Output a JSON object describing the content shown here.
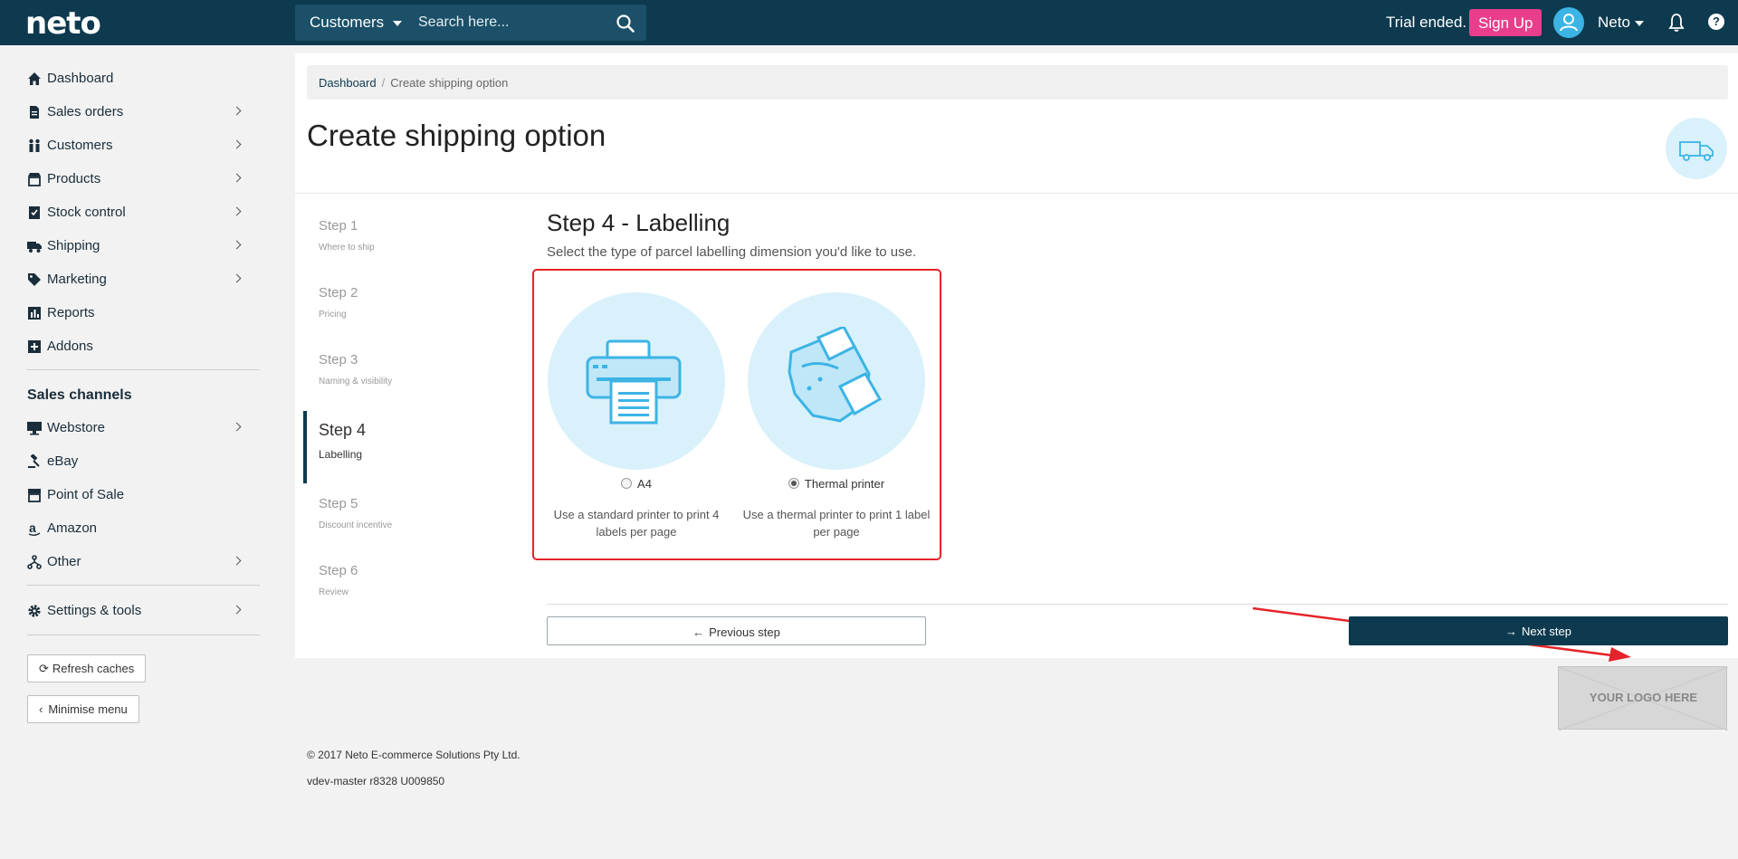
{
  "topbar": {
    "logo": "neto",
    "search_scope": "Customers",
    "search_placeholder": "Search here...",
    "trial_text": "Trial ended.",
    "signup_label": "Sign Up",
    "user_name": "Neto",
    "help_label": "?"
  },
  "sidebar": {
    "items": [
      {
        "label": "Dashboard",
        "icon": "home-icon"
      },
      {
        "label": "Sales orders",
        "icon": "document-icon"
      },
      {
        "label": "Customers",
        "icon": "people-icon"
      },
      {
        "label": "Products",
        "icon": "store-icon"
      },
      {
        "label": "Stock control",
        "icon": "checklist-icon"
      },
      {
        "label": "Shipping",
        "icon": "truck-icon"
      },
      {
        "label": "Marketing",
        "icon": "tag-icon"
      },
      {
        "label": "Reports",
        "icon": "bar-chart-icon"
      },
      {
        "label": "Addons",
        "icon": "plus-square-icon"
      }
    ],
    "channels_heading": "Sales channels",
    "channels": [
      {
        "label": "Webstore",
        "icon": "monitor-icon"
      },
      {
        "label": "eBay",
        "icon": "gavel-icon"
      },
      {
        "label": "Point of Sale",
        "icon": "register-icon"
      },
      {
        "label": "Amazon",
        "icon": "amazon-icon"
      },
      {
        "label": "Other",
        "icon": "branch-icon"
      }
    ],
    "settings_label": "Settings & tools",
    "refresh_label": "Refresh caches",
    "minimise_label": "Minimise menu"
  },
  "breadcrumb": {
    "home": "Dashboard",
    "separator": "/",
    "current": "Create shipping option"
  },
  "page_title": "Create shipping option",
  "steps": [
    {
      "num": "Step 1",
      "sub": "Where to ship"
    },
    {
      "num": "Step 2",
      "sub": "Pricing"
    },
    {
      "num": "Step 3",
      "sub": "Naming & visibility"
    },
    {
      "num": "Step 4",
      "sub": "Labelling"
    },
    {
      "num": "Step 5",
      "sub": "Discount incentive"
    },
    {
      "num": "Step 6",
      "sub": "Review"
    }
  ],
  "step_heading": "Step 4 - Labelling",
  "step_desc": "Select the type of parcel labelling dimension you'd like to use.",
  "options": [
    {
      "label": "A4",
      "desc": "Use a standard printer to print 4 labels per page",
      "checked": false
    },
    {
      "label": "Thermal printer",
      "desc": "Use a thermal printer to print 1 label per page",
      "checked": true
    }
  ],
  "prev_label": "Previous step",
  "next_label": "Next step",
  "logo_placeholder": "YOUR LOGO HERE",
  "footer": {
    "copyright": "© 2017 Neto E-commerce Solutions Pty Ltd.",
    "version": "vdev-master r8328 U009850"
  },
  "colors": {
    "topbar": "#0e3a4f",
    "accent_pink": "#e83e8c",
    "light_blue": "#d9f1fa",
    "icon_blue": "#3cb4e5",
    "annotation_red": "#e4242a"
  }
}
